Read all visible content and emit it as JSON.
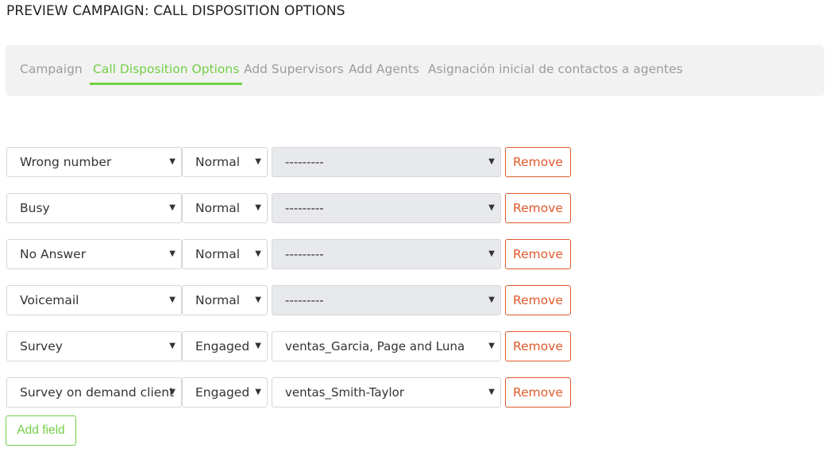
{
  "page": {
    "title": "PREVIEW CAMPAIGN: CALL DISPOSITION OPTIONS"
  },
  "tabs": [
    {
      "label": "Campaign",
      "active": false
    },
    {
      "label": "Call Disposition Options",
      "active": true
    },
    {
      "label": "Add Supervisors",
      "active": false
    },
    {
      "label": "Add Agents",
      "active": false
    },
    {
      "label": "Asignación inicial de contactos a agentes",
      "active": false
    }
  ],
  "rows": [
    {
      "disposition": "Wrong number",
      "type": "Normal",
      "form": "---------",
      "form_disabled": true,
      "remove_label": "Remove"
    },
    {
      "disposition": "Busy",
      "type": "Normal",
      "form": "---------",
      "form_disabled": true,
      "remove_label": "Remove"
    },
    {
      "disposition": "No Answer",
      "type": "Normal",
      "form": "---------",
      "form_disabled": true,
      "remove_label": "Remove"
    },
    {
      "disposition": "Voicemail",
      "type": "Normal",
      "form": "---------",
      "form_disabled": true,
      "remove_label": "Remove"
    },
    {
      "disposition": "Survey",
      "type": "Engaged",
      "form": "ventas_Garcia, Page and Luna",
      "form_disabled": false,
      "remove_label": "Remove"
    },
    {
      "disposition": "Survey on demand client",
      "type": "Engaged",
      "form": "ventas_Smith-Taylor",
      "form_disabled": false,
      "remove_label": "Remove"
    }
  ],
  "actions": {
    "add_field_label": "Add field"
  },
  "colors": {
    "accent": "#72cf45",
    "danger": "#e05a2b",
    "disabled_bg": "#e8e9ec"
  },
  "icons": {
    "dropdown": "caret-down-icon"
  }
}
